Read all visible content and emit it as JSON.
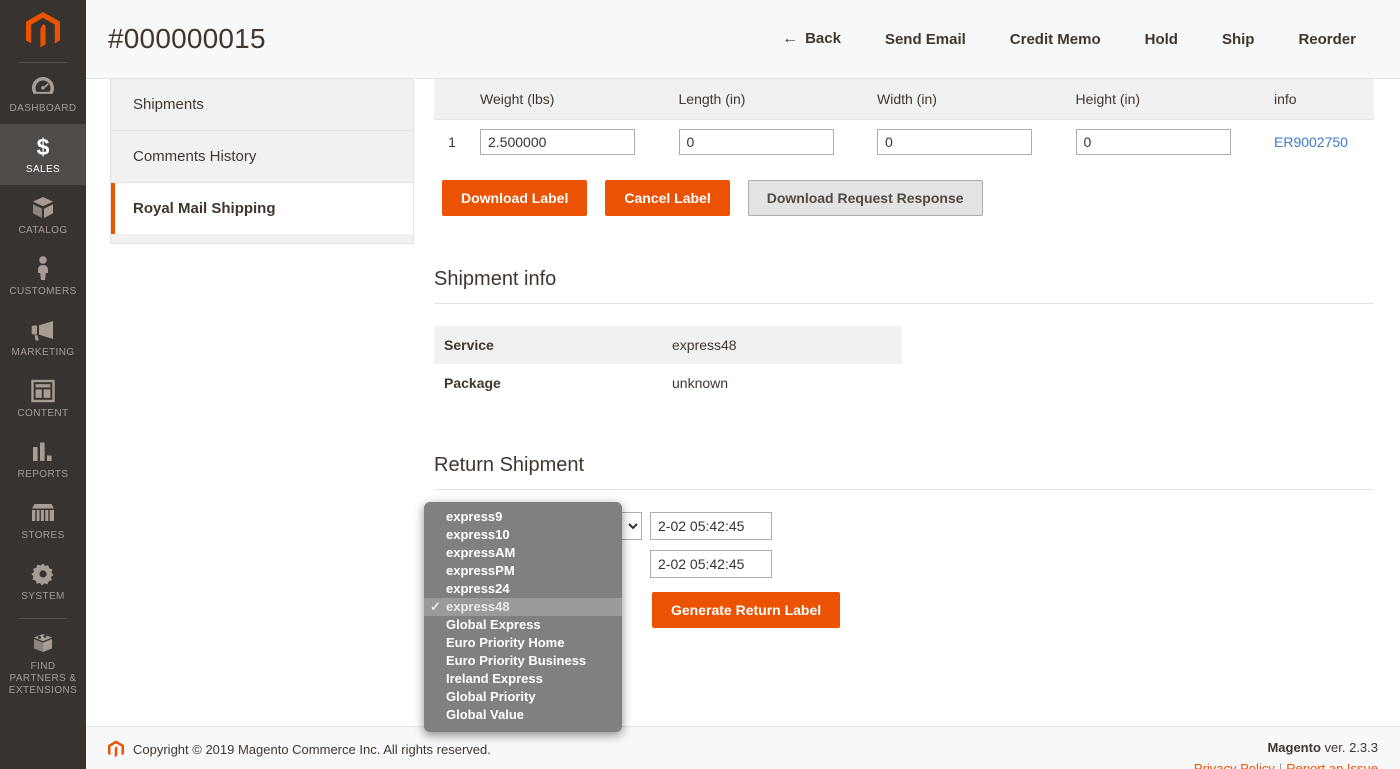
{
  "sidebar": {
    "logo_icon": "magento-logo-icon",
    "items": [
      {
        "label": "DASHBOARD",
        "icon": "dashboard-gauge-icon",
        "active": false
      },
      {
        "label": "SALES",
        "icon": "dollar-sign-icon",
        "active": true
      },
      {
        "label": "CATALOG",
        "icon": "boxes-icon",
        "active": false
      },
      {
        "label": "CUSTOMERS",
        "icon": "person-icon",
        "active": false
      },
      {
        "label": "MARKETING",
        "icon": "megaphone-icon",
        "active": false
      },
      {
        "label": "CONTENT",
        "icon": "layout-page-icon",
        "active": false
      },
      {
        "label": "REPORTS",
        "icon": "bar-chart-icon",
        "active": false
      },
      {
        "label": "STORES",
        "icon": "storefront-icon",
        "active": false
      },
      {
        "label": "SYSTEM",
        "icon": "gear-icon",
        "active": false
      },
      {
        "label": "FIND PARTNERS & EXTENSIONS",
        "icon": "building-blocks-icon",
        "active": false
      }
    ]
  },
  "header": {
    "title": "#000000015",
    "back_label": "Back",
    "back_icon": "arrow-left-icon",
    "actions": [
      {
        "label": "Send Email"
      },
      {
        "label": "Credit Memo"
      },
      {
        "label": "Hold"
      },
      {
        "label": "Ship"
      },
      {
        "label": "Reorder"
      }
    ]
  },
  "tabs": [
    {
      "label": "Shipments",
      "active": false
    },
    {
      "label": "Comments History",
      "active": false
    },
    {
      "label": "Royal Mail Shipping",
      "active": true
    }
  ],
  "packages": {
    "columns": [
      "",
      "Weight (lbs)",
      "Length (in)",
      "Width (in)",
      "Height (in)",
      "info"
    ],
    "rows": [
      {
        "index": "1",
        "weight": "2.500000",
        "length": "0",
        "width": "0",
        "height": "0",
        "info": "ER9002750"
      }
    ]
  },
  "label_actions": {
    "download_label": "Download Label",
    "cancel_label": "Cancel Label",
    "download_request_response": "Download Request Response"
  },
  "shipment_info": {
    "title": "Shipment info",
    "rows": [
      {
        "key": "Service",
        "value": "express48"
      },
      {
        "key": "Package",
        "value": "unknown"
      }
    ]
  },
  "return_shipment": {
    "title": "Return Shipment",
    "service_selected": "express48",
    "date_1": "2-02 05:42:45",
    "date_2": "2-02 05:42:45",
    "generate_label": "Generate Return Label",
    "options": [
      {
        "label": "express9",
        "selected": false
      },
      {
        "label": "express10",
        "selected": false
      },
      {
        "label": "expressAM",
        "selected": false
      },
      {
        "label": "expressPM",
        "selected": false
      },
      {
        "label": "express24",
        "selected": false
      },
      {
        "label": "express48",
        "selected": true
      },
      {
        "label": "Global Express",
        "selected": false
      },
      {
        "label": "Euro Priority Home",
        "selected": false
      },
      {
        "label": "Euro Priority Business",
        "selected": false
      },
      {
        "label": "Ireland Express",
        "selected": false
      },
      {
        "label": "Global Priority",
        "selected": false
      },
      {
        "label": "Global Value",
        "selected": false
      }
    ],
    "checkmark": "✓"
  },
  "footer": {
    "copyright": "Copyright © 2019 Magento Commerce Inc. All rights reserved.",
    "logo_icon": "magento-logo-icon",
    "brand": "Magento",
    "version": " ver. 2.3.3",
    "privacy_link": "Privacy Policy",
    "report_link": "Report an Issue"
  },
  "colors": {
    "accent": "#eb5202",
    "sidebar": "#373330",
    "link": "#3c7bc4"
  }
}
